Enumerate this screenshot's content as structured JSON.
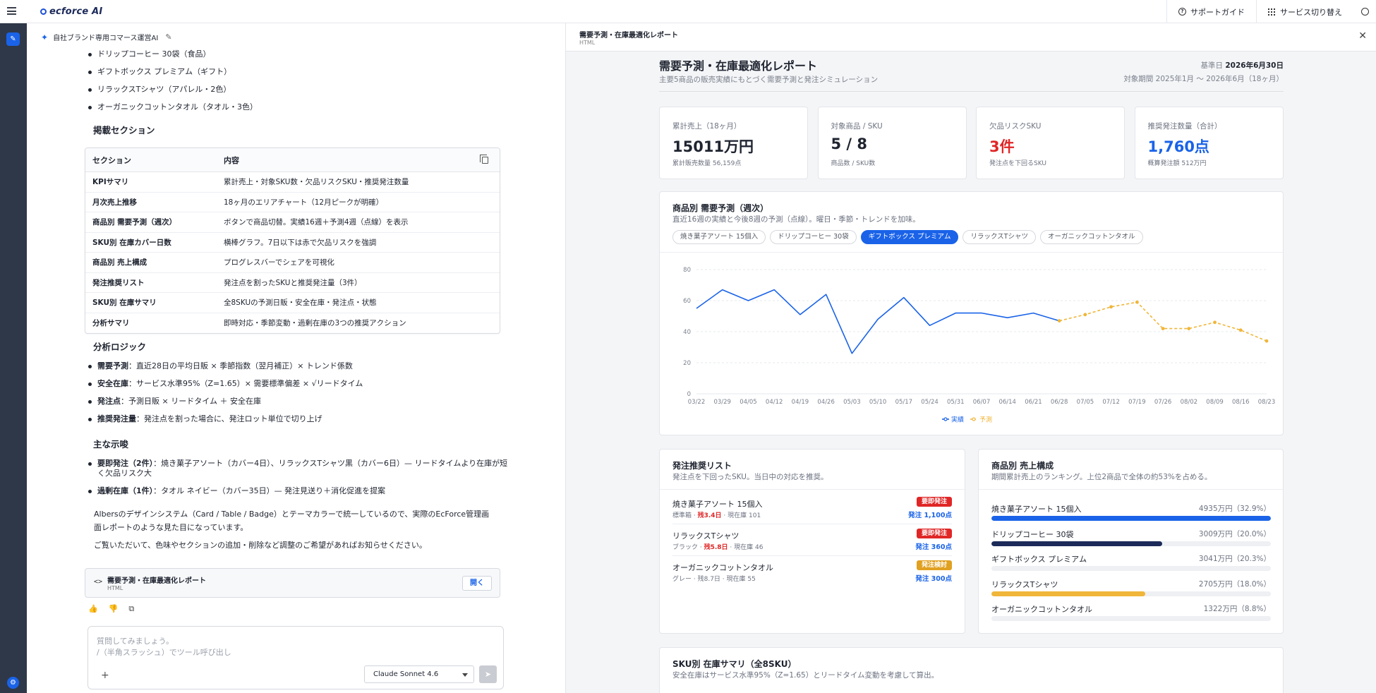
{
  "app": {
    "logo_text": "ecforce AI",
    "top_buttons": {
      "support": "サポートガイド",
      "switch": "サービス切り替え"
    }
  },
  "chat": {
    "title": "自社ブランド専用コマース運営AI",
    "product_list": [
      "ドリップコーヒー 30袋（食品）",
      "ギフトボックス プレミアム（ギフト）",
      "リラックスTシャツ（アパレル・2色）",
      "オーガニックコットンタオル（タオル・3色）"
    ],
    "sections_heading": "掲載セクション",
    "sections_table": {
      "headers": [
        "セクション",
        "内容"
      ],
      "rows": [
        [
          "KPIサマリ",
          "累計売上・対象SKU数・欠品リスクSKU・推奨発注数量"
        ],
        [
          "月次売上推移",
          "18ヶ月のエリアチャート（12月ピークが明確）"
        ],
        [
          "商品別 需要予測（週次）",
          "ボタンで商品切替。実績16週＋予測4週（点線）を表示"
        ],
        [
          "SKU別 在庫カバー日数",
          "横棒グラフ。7日以下は赤で欠品リスクを強調"
        ],
        [
          "商品別 売上構成",
          "プログレスバーでシェアを可視化"
        ],
        [
          "発注推奨リスト",
          "発注点を割ったSKUと推奨発注量（3件）"
        ],
        [
          "SKU別 在庫サマリ",
          "全8SKUの予測日販・安全在庫・発注点・状態"
        ],
        [
          "分析サマリ",
          "即時対応・季節変動・過剰在庫の3つの推奨アクション"
        ]
      ]
    },
    "logic_heading": "分析ロジック",
    "logic": [
      {
        "b": "需要予測",
        "t": "：直近28日の平均日販 × 季節指数（翌月補正）× トレンド係数"
      },
      {
        "b": "安全在庫",
        "t": "：サービス水準95%（Z=1.65）× 需要標準偏差 × √リードタイム"
      },
      {
        "b": "発注点",
        "t": "：予測日販 × リードタイム ＋ 安全在庫"
      },
      {
        "b": "推奨発注量",
        "t": "：発注点を割った場合に、発注ロット単位で切り上げ"
      }
    ],
    "insights_heading": "主な示唆",
    "insights": [
      {
        "b": "要即発注（2件）",
        "t": "：焼き菓子アソート（カバー4日）、リラックスTシャツ黒（カバー6日）— リードタイムより在庫が短く欠品リスク大"
      },
      {
        "b": "過剰在庫（1件）",
        "t": "：タオル ネイビー（カバー35日）— 発注見送り＋消化促進を提案"
      }
    ],
    "closing1": "Albersのデザインシステム（Card / Table / Badge）とテーマカラーで統一しているので、実際のEcForce管理画面レポートのような見た目になっています。",
    "closing2": "ご覧いただいて、色味やセクションの追加・削除など調整のご希望があればお知らせください。",
    "artifact": {
      "title": "需要予測・在庫最適化レポート",
      "type": "HTML",
      "open_label": "開く"
    },
    "input": {
      "placeholder1": "質問してみましょう。",
      "placeholder2": "/（半角スラッシュ）でツール呼び出し",
      "model": "Claude Sonnet 4.6"
    }
  },
  "report": {
    "panel_title": "需要予測・在庫最適化レポート",
    "panel_type": "HTML",
    "title": "需要予測・在庫最適化レポート",
    "subtitle": "主要5商品の販売実績にもとづく需要予測と発注シミュレーション",
    "date_label": "基準日",
    "date_value": "2026年6月30日",
    "period": "対象期間 2025年1月 〜 2026年6月（18ヶ月）",
    "kpis": [
      {
        "label": "累計売上（18ヶ月）",
        "value": "15011万円",
        "sub": "累計販売数量 56,159点",
        "color": "#1f2430"
      },
      {
        "label": "対象商品 / SKU",
        "value": "5 / 8",
        "sub": "商品数 / SKU数",
        "color": "#1f2430"
      },
      {
        "label": "欠品リスクSKU",
        "value": "3件",
        "sub": "発注点を下回るSKU",
        "color": "#e02626"
      },
      {
        "label": "推奨発注数量（合計）",
        "value": "1,760点",
        "sub": "概算発注額 512万円",
        "color": "#1a63e8"
      }
    ],
    "forecast": {
      "title": "商品別 需要予測（週次）",
      "subtitle": "直近16週の実績と今後8週の予測（点線）。曜日・季節・トレンドを加味。",
      "tabs": [
        "焼き菓子アソート 15個入",
        "ドリップコーヒー 30袋",
        "ギフトボックス プレミアム",
        "リラックスTシャツ",
        "オーガニックコットンタオル"
      ],
      "active_tab": 2
    },
    "recommend": {
      "title": "発注推奨リスト",
      "subtitle": "発注点を下回ったSKU。当日中の対応を推奨。",
      "items": [
        {
          "name": "焼き菓子アソート 15個入",
          "variant": "標準箱",
          "sep": " · ",
          "cover": "残3.4日",
          "stock": "現在庫 101",
          "badge": "要即発注",
          "badge_color": "#e02626",
          "qty": "発注 1,100点",
          "warn": true
        },
        {
          "name": "リラックスTシャツ",
          "variant": "ブラック",
          "sep": " · ",
          "cover": "残5.8日",
          "stock": "現在庫 46",
          "badge": "要即発注",
          "badge_color": "#e02626",
          "qty": "発注 360点",
          "warn": true
        },
        {
          "name": "オーガニックコットンタオル",
          "variant": "グレー",
          "sep": " · ",
          "cover": "残8.7日",
          "stock": "現在庫 55",
          "badge": "発注検討",
          "badge_color": "#e0a020",
          "qty": "発注 300点",
          "warn": false
        }
      ]
    },
    "share": {
      "title": "商品別 売上構成",
      "subtitle": "期間累計売上のランキング。上位2商品で全体の約53%を占める。",
      "items": [
        {
          "name": "焼き菓子アソート 15個入",
          "value": "4935万円（32.9%）",
          "pct": 100,
          "color": "#1a63e8"
        },
        {
          "name": "ドリップコーヒー 30袋",
          "value": "3009万円（20.0%）",
          "pct": 61,
          "color": "#1c2a5a"
        },
        {
          "name": "ギフトボックス プレミアム",
          "value": "3041万円（20.3%）",
          "pct": 0,
          "color": "#1a63e8"
        },
        {
          "name": "リラックスTシャツ",
          "value": "2705万円（18.0%）",
          "pct": 55,
          "color": "#f0b63a"
        },
        {
          "name": "オーガニックコットンタオル",
          "value": "1322万円（8.8%）",
          "pct": 0,
          "color": "#1a63e8"
        }
      ]
    },
    "sku_summary": {
      "title": "SKU別 在庫サマリ（全8SKU）",
      "subtitle": "安全在庫はサービス水準95%（Z=1.65）とリードタイム変動を考慮して算出。"
    }
  },
  "chart_data": {
    "type": "line",
    "title": "商品別 需要予測（週次）",
    "x": [
      "03/22",
      "03/29",
      "04/05",
      "04/12",
      "04/19",
      "04/26",
      "05/03",
      "05/10",
      "05/17",
      "05/24",
      "05/31",
      "06/07",
      "06/14",
      "06/21",
      "06/28",
      "07/05",
      "07/12",
      "07/19",
      "07/26",
      "08/02",
      "08/09",
      "08/16",
      "08/23"
    ],
    "ylim": [
      0,
      80
    ],
    "yticks": [
      0,
      20,
      40,
      60,
      80
    ],
    "grid": true,
    "legend": "bottom",
    "series": [
      {
        "name": "実績",
        "color": "#1a63e8",
        "dashed": false,
        "start": 0,
        "values": [
          55,
          67,
          60,
          67,
          51,
          64,
          26,
          48,
          62,
          44,
          52,
          52,
          49,
          52,
          47
        ]
      },
      {
        "name": "予測",
        "color": "#f0b63a",
        "dashed": true,
        "start": 14,
        "values": [
          47,
          51,
          56,
          59,
          42,
          42,
          46,
          41,
          34
        ]
      }
    ]
  }
}
